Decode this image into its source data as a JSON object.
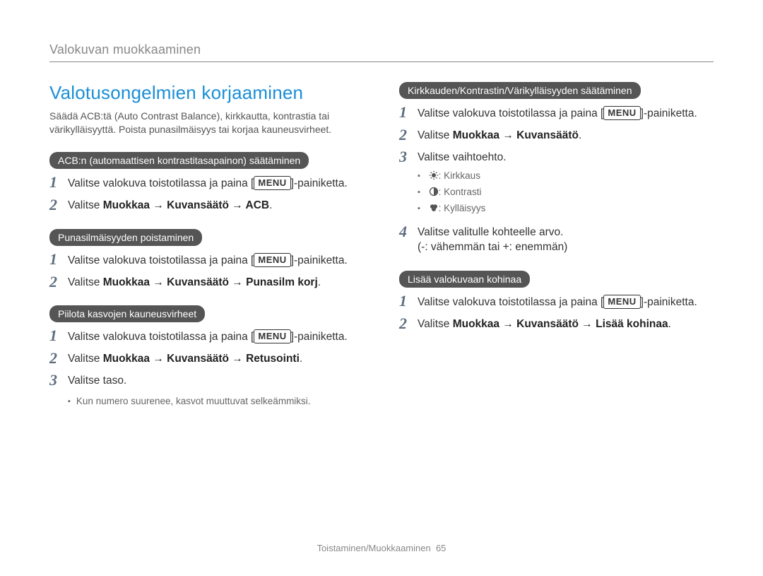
{
  "header": {
    "breadcrumb": "Valokuvan muokkaaminen"
  },
  "left": {
    "title": "Valotusongelmien korjaaminen",
    "intro": "Säädä ACB:tä (Auto Contrast Balance), kirkkautta, kontrastia tai värikylläisyyttä. Poista punasilmäisyys tai korjaa kauneusvirheet.",
    "sections": {
      "acb": {
        "pill": "ACB:n (automaattisen kontrastitasapainon) säätäminen",
        "step1_a": "Valitse valokuva toistotilassa ja paina [",
        "step1_menu": "MENU",
        "step1_c": "]-painiketta.",
        "step2_a": "Valitse ",
        "step2_b": "Muokkaa → Kuvansäätö → ACB",
        "step2_c": "."
      },
      "redeye": {
        "pill": "Punasilmäisyyden poistaminen",
        "step1_a": "Valitse valokuva toistotilassa ja paina [",
        "step1_menu": "MENU",
        "step1_c": "]-painiketta.",
        "step2_a": "Valitse ",
        "step2_b": "Muokkaa → Kuvansäätö → Punasilm korj",
        "step2_c": "."
      },
      "beauty": {
        "pill": "Piilota kasvojen kauneusvirheet",
        "step1_a": "Valitse valokuva toistotilassa ja paina [",
        "step1_menu": "MENU",
        "step1_c": "]-painiketta.",
        "step2_a": "Valitse ",
        "step2_b": "Muokkaa → Kuvansäätö → Retusointi",
        "step2_c": ".",
        "step3": "Valitse taso.",
        "note": "Kun numero suurenee, kasvot muuttuvat selkeämmiksi."
      }
    }
  },
  "right": {
    "sections": {
      "bcs": {
        "pill": "Kirkkauden/Kontrastin/Värikylläisyyden säätäminen",
        "step1_a": "Valitse valokuva toistotilassa ja paina [",
        "step1_menu": "MENU",
        "step1_c": "]-painiketta.",
        "step2_a": "Valitse ",
        "step2_b": "Muokkaa → Kuvansäätö",
        "step2_c": ".",
        "step3": "Valitse vaihtoehto.",
        "opt_brightness": ": Kirkkaus",
        "opt_contrast": ": Kontrasti",
        "opt_saturation": ": Kylläisyys",
        "step4_a": "Valitse valitulle kohteelle arvo.",
        "step4_b": "(-: vähemmän tai +: enemmän)"
      },
      "noise": {
        "pill": "Lisää valokuvaan kohinaa",
        "step1_a": "Valitse valokuva toistotilassa ja paina [",
        "step1_menu": "MENU",
        "step1_c": "]-painiketta.",
        "step2_a": "Valitse ",
        "step2_b": "Muokkaa → Kuvansäätö → Lisää kohinaa",
        "step2_c": "."
      }
    }
  },
  "footer": {
    "section": "Toistaminen/Muokkaaminen",
    "page": "65"
  }
}
